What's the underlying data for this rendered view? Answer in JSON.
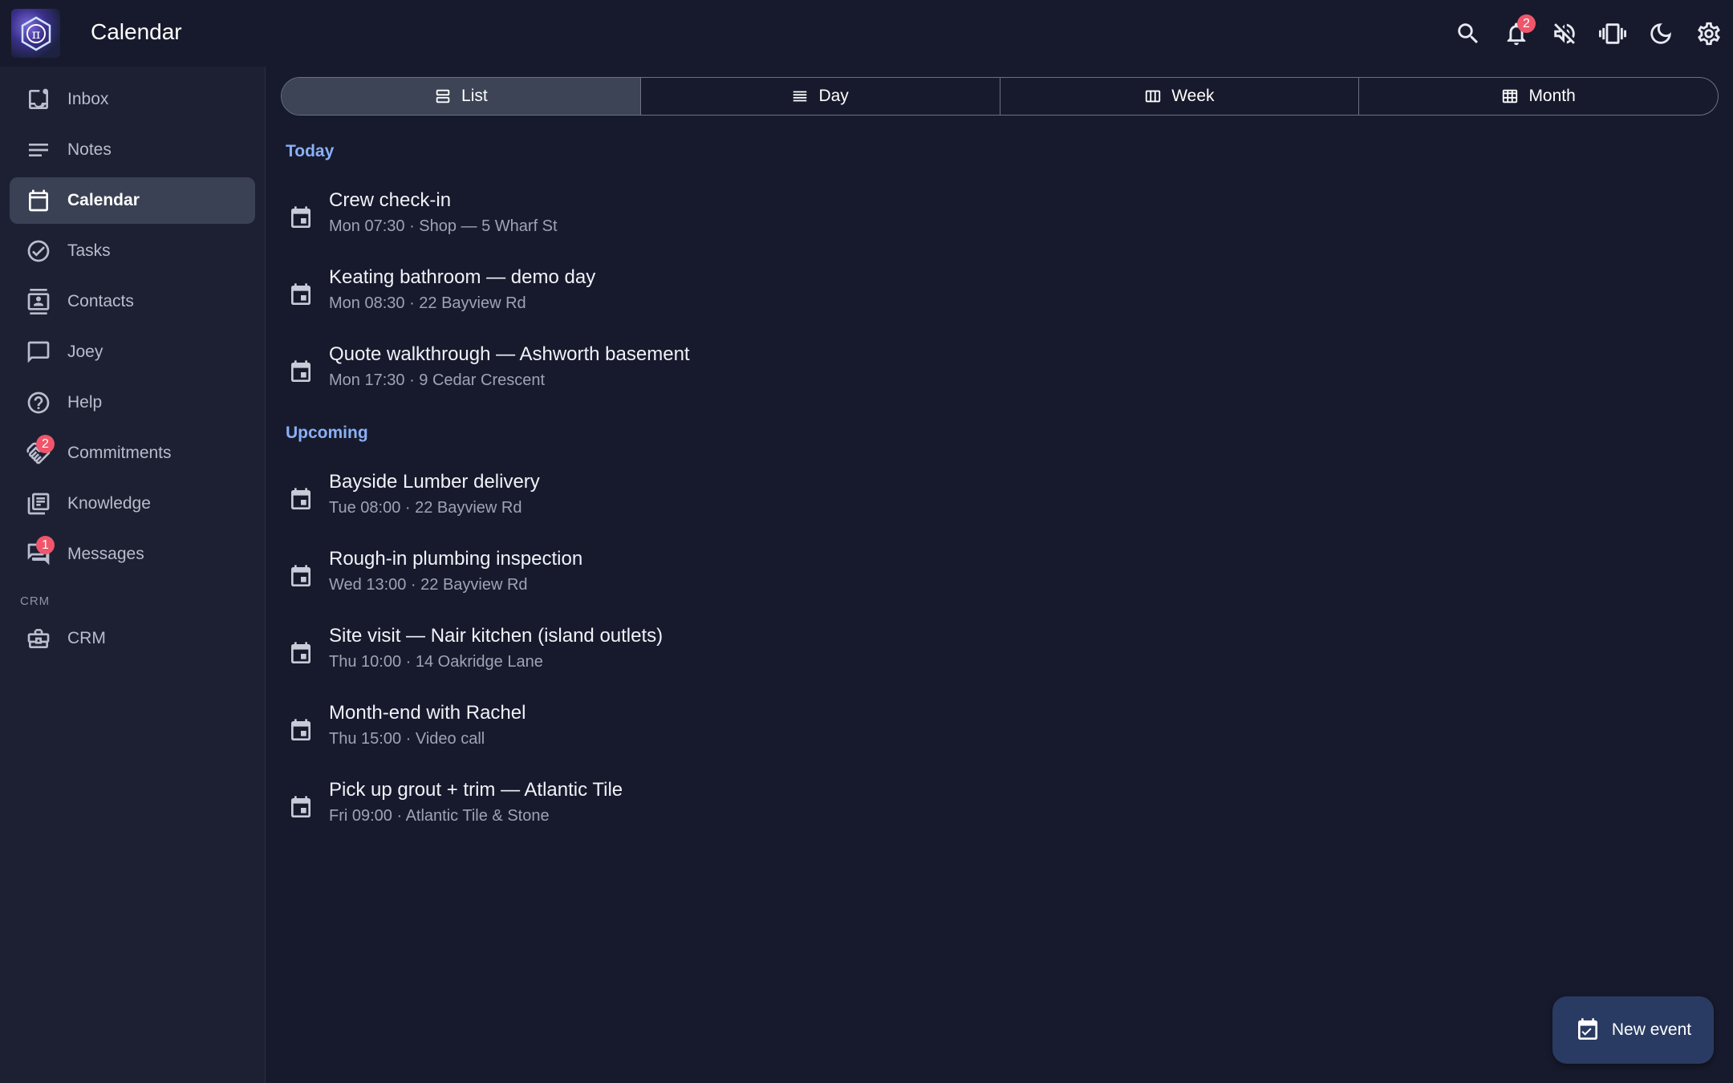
{
  "header": {
    "title": "Calendar",
    "notification_count": "2",
    "icons": [
      "search-icon",
      "bell-icon",
      "mute-icon",
      "vibrate-icon",
      "moon-icon",
      "gear-icon"
    ]
  },
  "sidebar": {
    "items": [
      {
        "label": "Inbox",
        "icon": "inbox-icon"
      },
      {
        "label": "Notes",
        "icon": "notes-icon"
      },
      {
        "label": "Calendar",
        "icon": "calendar-icon",
        "active": true
      },
      {
        "label": "Tasks",
        "icon": "check-circle-icon"
      },
      {
        "label": "Contacts",
        "icon": "contacts-icon"
      },
      {
        "label": "Joey",
        "icon": "chat-icon"
      },
      {
        "label": "Help",
        "icon": "help-icon"
      },
      {
        "label": "Commitments",
        "icon": "handshake-icon",
        "badge": "2"
      },
      {
        "label": "Knowledge",
        "icon": "library-icon"
      },
      {
        "label": "Messages",
        "icon": "messages-icon",
        "badge": "1"
      }
    ],
    "section_label": "CRM",
    "crm_item": {
      "label": "CRM",
      "icon": "briefcase-icon"
    }
  },
  "views": {
    "list": "List",
    "day": "Day",
    "week": "Week",
    "month": "Month",
    "selected": "List"
  },
  "today": {
    "heading": "Today",
    "events": [
      {
        "title": "Crew check-in",
        "detail": "Mon 07:30 · Shop — 5 Wharf St"
      },
      {
        "title": "Keating bathroom — demo day",
        "detail": "Mon 08:30 · 22 Bayview Rd"
      },
      {
        "title": "Quote walkthrough — Ashworth basement",
        "detail": "Mon 17:30 · 9 Cedar Crescent"
      }
    ]
  },
  "upcoming": {
    "heading": "Upcoming",
    "events": [
      {
        "title": "Bayside Lumber delivery",
        "detail": "Tue 08:00 · 22 Bayview Rd"
      },
      {
        "title": "Rough-in plumbing inspection",
        "detail": "Wed 13:00 · 22 Bayview Rd"
      },
      {
        "title": "Site visit — Nair kitchen (island outlets)",
        "detail": "Thu 10:00 · 14 Oakridge Lane"
      },
      {
        "title": "Month-end with Rachel",
        "detail": "Thu 15:00 · Video call"
      },
      {
        "title": "Pick up grout + trim — Atlantic Tile",
        "detail": "Fri 09:00 · Atlantic Tile & Stone"
      }
    ]
  },
  "fab": {
    "label": "New event"
  },
  "colors": {
    "background": "#171a2c",
    "sidebar": "#1d2033",
    "accent": "#8ab0f5",
    "badge": "#f0566b",
    "fab": "#2a3b63"
  }
}
